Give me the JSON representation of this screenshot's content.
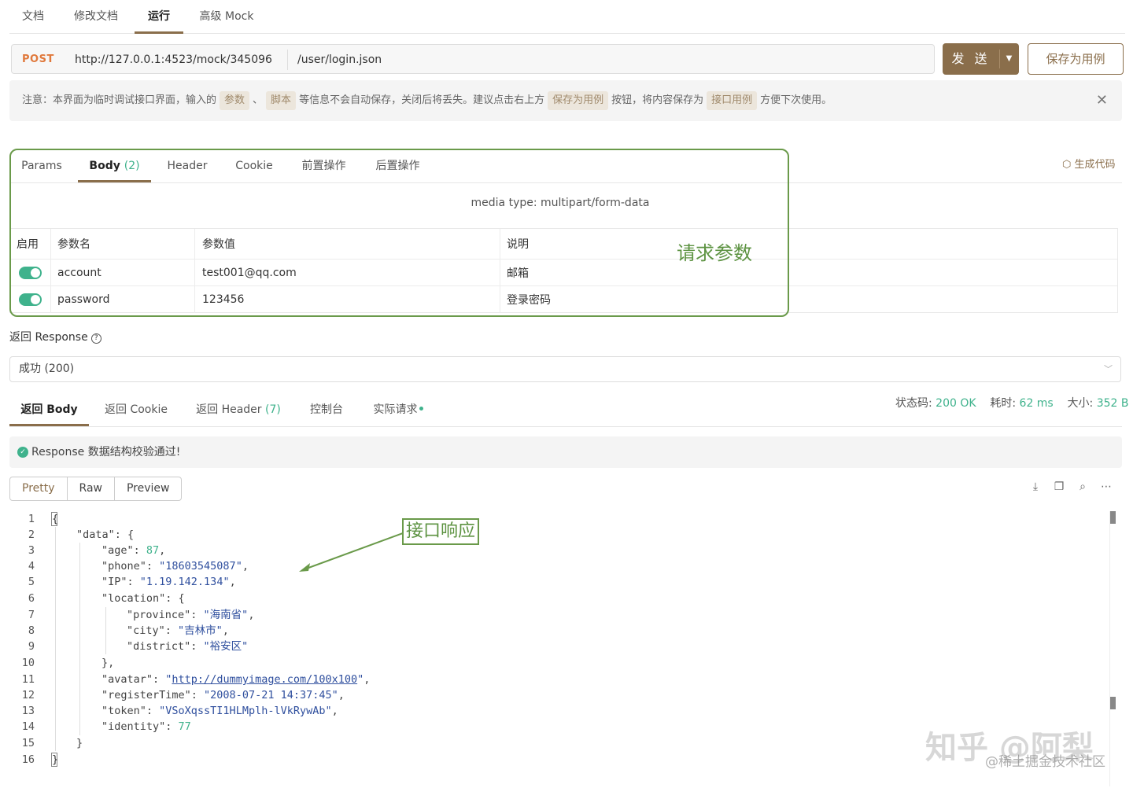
{
  "top_tabs": [
    "文档",
    "修改文档",
    "运行",
    "高级 Mock"
  ],
  "request": {
    "method": "POST",
    "base_url": "http://127.0.0.1:4523/mock/345096",
    "path": "/user/login.json",
    "send_label": "发 送",
    "save_label": "保存为用例"
  },
  "notice": {
    "p1": "注意：本界面为临时调试接口界面，输入的",
    "tag1": "参数",
    "p2": "、",
    "tag2": "脚本",
    "p3": "等信息不会自动保存，关闭后将丢失。建议点击右上方",
    "tag3": "保存为用例",
    "p4": "按钮，将内容保存为",
    "tag4": "接口用例",
    "p5": "方便下次使用。",
    "close": "✕"
  },
  "req_tabs": {
    "params": "Params",
    "body": "Body",
    "body_count": "(2)",
    "header": "Header",
    "cookie": "Cookie",
    "pre": "前置操作",
    "post": "后置操作"
  },
  "gen_code": "生成代码",
  "media_type": "media type: multipart/form-data",
  "params_table": {
    "headers": [
      "启用",
      "参数名",
      "参数值",
      "说明"
    ],
    "rows": [
      {
        "name": "account",
        "value": "test001@qq.com",
        "desc": "邮箱"
      },
      {
        "name": "password",
        "value": "123456",
        "desc": "登录密码"
      }
    ]
  },
  "annotations": {
    "request": "请求参数",
    "response": "接口响应"
  },
  "response": {
    "title": "返回 Response",
    "select_value": "成功 (200)",
    "tabs": {
      "body": "返回 Body",
      "cookie": "返回 Cookie",
      "header": "返回 Header",
      "header_count": "(7)",
      "console": "控制台",
      "actual": "实际请求"
    },
    "stats": {
      "status_label": "状态码:",
      "status_value": "200 OK",
      "time_label": "耗时:",
      "time_value": "62 ms",
      "size_label": "大小:",
      "size_value": "352 B"
    },
    "validation": "Response 数据结构校验通过!",
    "views": [
      "Pretty",
      "Raw",
      "Preview"
    ]
  },
  "code": {
    "lines": [
      "{",
      "\"data\": {",
      "\"age\": 87,",
      "\"phone\": \"18603545087\",",
      "\"IP\": \"1.19.142.134\",",
      "\"location\": {",
      "\"province\": \"海南省\",",
      "\"city\": \"吉林市\",",
      "\"district\": \"裕安区\"",
      "},",
      "\"avatar\": \"http://dummyimage.com/100x100\",",
      "\"registerTime\": \"2008-07-21 14:37:45\",",
      "\"token\": \"VSoXqssTI1HLMplh-lVkRywAb\",",
      "\"identity\": 77",
      "}",
      "}"
    ]
  },
  "watermark": {
    "main": "知乎 @阿梨",
    "sub": "@稀土掘金技术社区"
  },
  "colors": {
    "accent": "#8a6e4b",
    "success": "#3fb28c",
    "method": "#e0793c",
    "annotation": "#5d9342"
  }
}
